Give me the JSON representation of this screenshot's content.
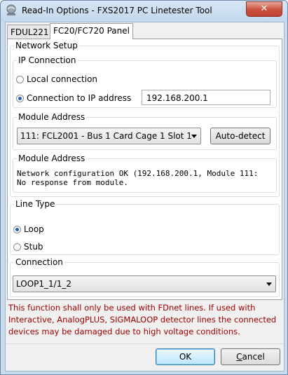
{
  "window": {
    "title": "Read-In Options - FXS2017 PC Linetester Tool",
    "close_glyph": "✕",
    "icon": "app-icon"
  },
  "tabs": [
    {
      "label": "FDUL221",
      "active": false
    },
    {
      "label": "FC20/FC720 Panel",
      "active": true
    }
  ],
  "network_setup": {
    "legend": "Network Setup",
    "ip_connection": {
      "legend": "IP Connection",
      "local_label": "Local connection",
      "ip_label": "Connection to IP address",
      "selected": "ip",
      "ip_value": "192.168.200.1"
    },
    "module_address": {
      "legend": "Module Address",
      "selected_value": "111: FCL2001 - Bus 1 Card Cage 1 Slot 1",
      "autodetect_label": "Auto-detect"
    },
    "module_status": {
      "legend": "Module Address",
      "line1": "Network configuration OK (192.168.200.1, Module 111:",
      "line2": "No response from module."
    }
  },
  "line_type": {
    "legend": "Line Type",
    "loop_label": "Loop",
    "stub_label": "Stub",
    "selected": "loop"
  },
  "connection": {
    "legend": "Connection",
    "selected_value": "LOOP1_1/1_2"
  },
  "warning_text": "This function shall only be used with FDnet lines. If used with Interactive, AnalogPLUS, SIGMALOOP detector lines the connected devices may be damaged due to high voltage conditions.",
  "buttons": {
    "ok": "OK",
    "cancel_prefix": "C",
    "cancel_rest": "ancel"
  },
  "colors": {
    "warning": "#a10000",
    "radio_selected": "#1f5fb8"
  }
}
